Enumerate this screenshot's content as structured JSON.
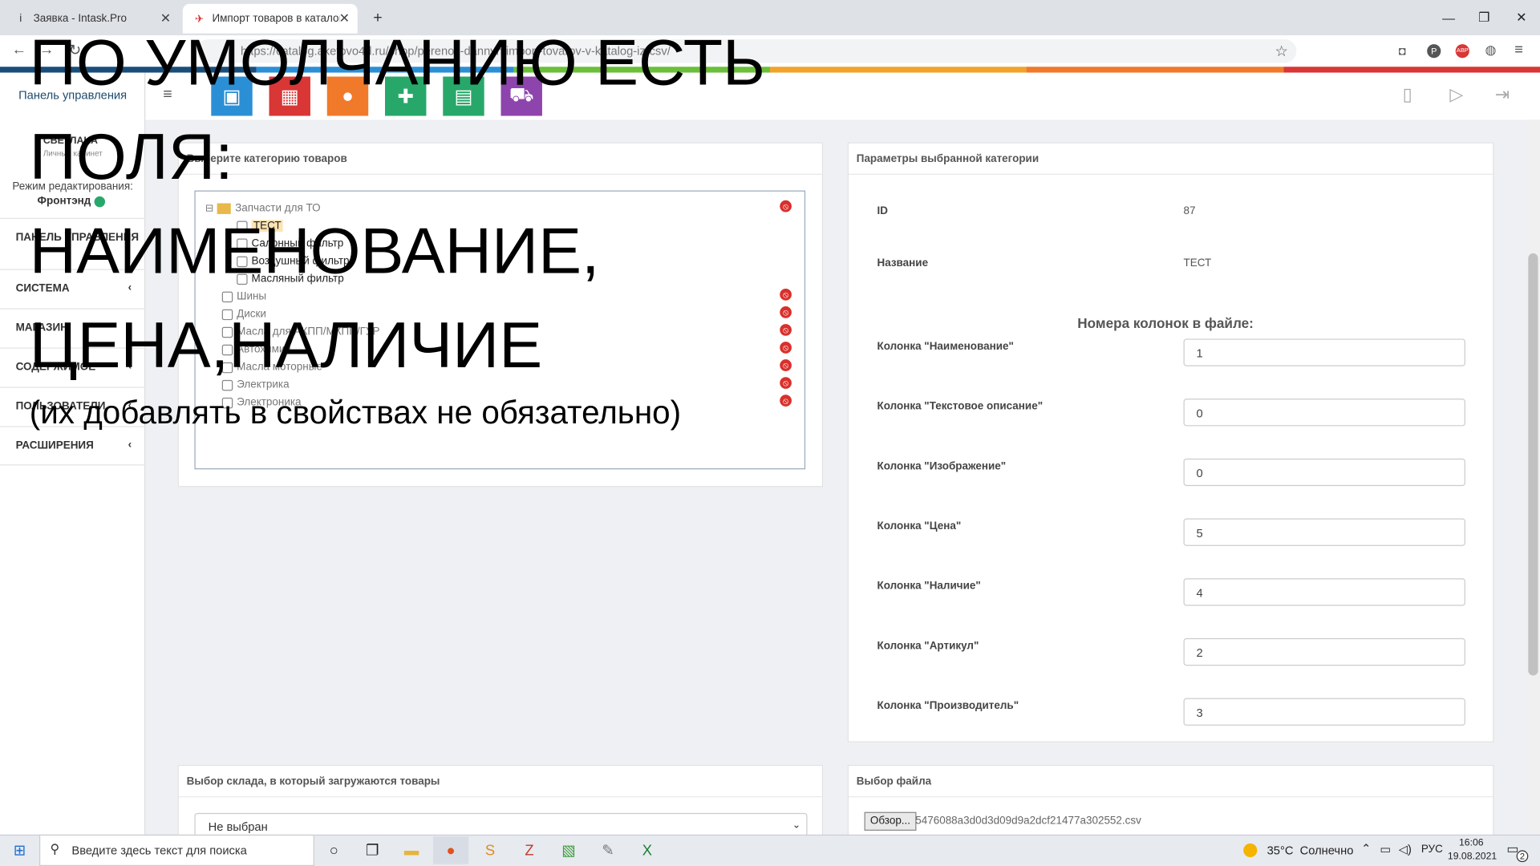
{
  "browser": {
    "tabs": [
      {
        "label": "Заявка - Intask.Pro",
        "icon": "i"
      },
      {
        "label": "Импорт товаров в каталог из С",
        "icon": "✈"
      }
    ],
    "new_tab": "+",
    "url": "https://catalog.aketovo4d.ru/shop/perenos-dannyh/import-tovarov-v-katalog-iz-csv/",
    "rainbow_colors": [
      "#1a4d7a",
      "#2b8fd6",
      "#6bbf3a",
      "#f2a32a",
      "#f07a2a",
      "#d93636"
    ]
  },
  "sidebar": {
    "title": "Панель управления",
    "user": {
      "name": "СВЕТЛАНА",
      "sub": "Личный кабинет"
    },
    "edit_mode_label": "Режим редактирования:",
    "edit_mode_value": "Фронтэнд",
    "items": [
      {
        "label": "ПАНЕЛЬ УПРАВЛЕНИЯ"
      },
      {
        "label": "СИСТЕМА"
      },
      {
        "label": "МАГАЗИН"
      },
      {
        "label": "СОДЕРЖИМОЕ"
      },
      {
        "label": "ПОЛЬЗОВАТЕЛИ"
      },
      {
        "label": "РАСШИРЕНИЯ"
      }
    ]
  },
  "toolbar": {
    "tiles": [
      {
        "icon": "cube-icon",
        "color": "#2b8fd6"
      },
      {
        "icon": "store-icon",
        "color": "#d93636"
      },
      {
        "icon": "user-icon",
        "color": "#f07a2a"
      },
      {
        "icon": "user-add-icon",
        "color": "#2aa56a"
      },
      {
        "icon": "book-icon",
        "color": "#27a86a"
      },
      {
        "icon": "cart-icon",
        "color": "#8e44ad"
      }
    ]
  },
  "category_panel": {
    "title": "Выберите категорию товаров",
    "root": "Запчасти для ТО",
    "children": [
      "ТЕСТ",
      "Салонный фильтр",
      "Воздушный фильтр",
      "Масляный фильтр"
    ],
    "others": [
      "Шины",
      "Диски",
      "Масла для АКПП/МКПП/ГУР",
      "Автохимия",
      "Масла моторные",
      "Электрика",
      "Электроника"
    ]
  },
  "params_panel": {
    "title": "Параметры выбранной категории",
    "id_label": "ID",
    "id_value": "87",
    "name_label": "Название",
    "name_value": "ТЕСТ",
    "columns_heading": "Номера колонок в файле:",
    "columns": [
      {
        "label": "Колонка \"Наименование\"",
        "value": "1"
      },
      {
        "label": "Колонка \"Текстовое описание\"",
        "value": "0"
      },
      {
        "label": "Колонка \"Изображение\"",
        "value": "0"
      },
      {
        "label": "Колонка \"Цена\"",
        "value": "5"
      },
      {
        "label": "Колонка \"Наличие\"",
        "value": "4"
      },
      {
        "label": "Колонка \"Артикул\"",
        "value": "2"
      },
      {
        "label": "Колонка \"Производитель\"",
        "value": "3"
      }
    ]
  },
  "warehouse_panel": {
    "title": "Выбор склада, в который загружаются товары",
    "selected": "Не выбран"
  },
  "file_panel": {
    "title": "Выбор файла",
    "browse": "Обзор...",
    "filename": "5476088a3d0d3d09d9a2dcf21477a302552.csv"
  },
  "overlay": {
    "lines": [
      "ПО УМОЛЧАНИЮ ЕСТЬ",
      "ПОЛЯ:",
      "НАИМЕНОВАНИЕ,",
      "ЦЕНА,НАЛИЧИЕ"
    ],
    "note": "(их добавлять в свойствах не обязательно)"
  },
  "taskbar": {
    "search_placeholder": "Введите здесь текст для поиска",
    "weather": "35°C  Солнечно",
    "lang": "РУС",
    "time": "16:06",
    "date": "19.08.2021",
    "notif": "2"
  }
}
